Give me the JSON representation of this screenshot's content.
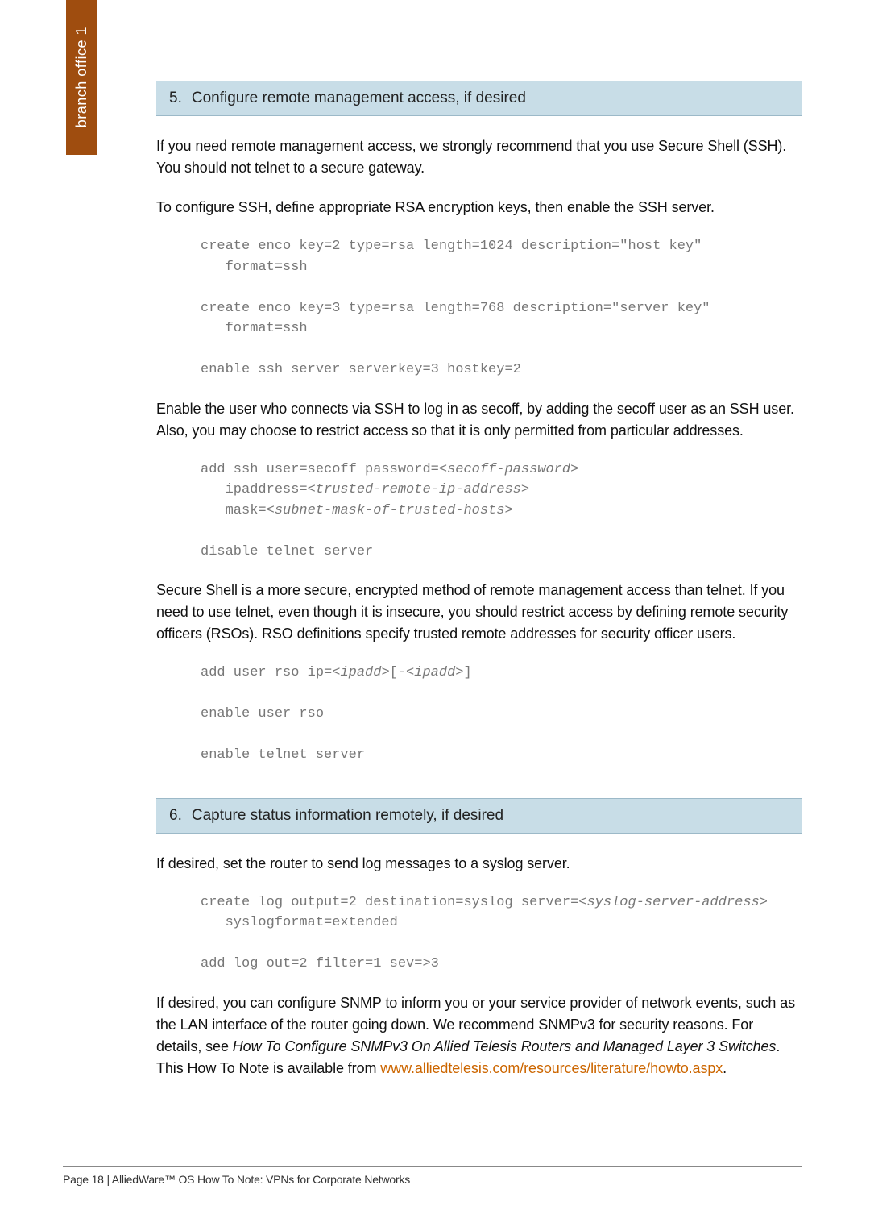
{
  "side_tab": "branch office 1",
  "step5": {
    "num": "5.",
    "title": "Configure remote management access, if desired",
    "p1": "If you need remote management access, we strongly recommend that you use Secure Shell (SSH). You should not telnet to a secure gateway.",
    "p2": "To configure SSH, define appropriate RSA encryption keys, then enable the SSH server.",
    "code1_l1": "create enco key=2 type=rsa length=1024 description=\"host key\"",
    "code1_l2": "   format=ssh",
    "code1_l3": "create enco key=3 type=rsa length=768 description=\"server key\"",
    "code1_l4": "   format=ssh",
    "code1_l5": "enable ssh server serverkey=3 hostkey=2",
    "p3": "Enable the user who connects via SSH to log in as secoff, by adding the secoff user as an SSH user. Also, you may choose to restrict access so that it is only permitted from particular addresses.",
    "code2_l1a": "add ssh user=secoff password=<",
    "code2_l1b": "secoff-password",
    "code2_l1c": ">",
    "code2_l2a": "   ipaddress=<",
    "code2_l2b": "trusted-remote-ip-address",
    "code2_l2c": ">",
    "code2_l3a": "   mask=<",
    "code2_l3b": "subnet-mask-of-trusted-hosts",
    "code2_l3c": ">",
    "code2_l4": "disable telnet server",
    "p4": "Secure Shell is a more secure, encrypted method of remote management access than telnet. If you need to use telnet, even though it is insecure, you should restrict access by defining remote security officers (RSOs). RSO definitions specify trusted remote addresses for security officer users.",
    "code3_l1a": "add user rso ip=<",
    "code3_l1b": "ipadd",
    "code3_l1c": ">[-<",
    "code3_l1d": "ipadd",
    "code3_l1e": ">]",
    "code3_l2": "enable user rso",
    "code3_l3": "enable telnet server"
  },
  "step6": {
    "num": "6.",
    "title": "Capture status information remotely, if desired",
    "p1": "If desired, set the router to send log messages to a syslog server.",
    "code1_l1a": "create log output=2 destination=syslog server=<",
    "code1_l1b": "syslog-server-address",
    "code1_l1c": ">",
    "code1_l2": "   syslogformat=extended",
    "code1_l3": "add log out=2 filter=1 sev=>3",
    "p2_a": "If desired, you can configure SNMP to inform you or your service provider of network events, such as the LAN interface of the router going down. We recommend SNMPv3 for security reasons. For details, see ",
    "p2_b": "How To Configure SNMPv3 On Allied Telesis Routers and Managed Layer 3 Switches",
    "p2_c": ". This How To Note is available from ",
    "p2_link": "www.alliedtelesis.com/resources/literature/howto.aspx",
    "p2_d": "."
  },
  "footer": "Page 18 | AlliedWare™ OS How To Note: VPNs for Corporate Networks"
}
